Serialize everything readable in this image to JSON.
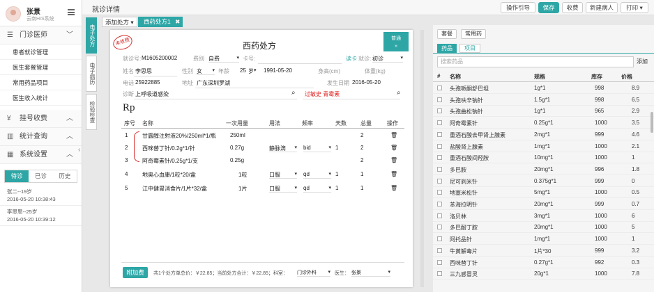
{
  "app": {
    "name": "张景",
    "subtitle": "云南HIS系统"
  },
  "sidebar": {
    "sections": [
      {
        "label": "门诊医师"
      },
      {
        "label": "挂号收费"
      },
      {
        "label": "统计查询"
      },
      {
        "label": "系统设置"
      }
    ],
    "sub_items": [
      {
        "label": "患者就诊管理"
      },
      {
        "label": "医生套餐管理"
      },
      {
        "label": "常用药品项目"
      },
      {
        "label": "医生收入统计"
      }
    ],
    "patient_tabs": [
      {
        "label": "待诊"
      },
      {
        "label": "已诊"
      },
      {
        "label": "历史"
      }
    ],
    "patients": [
      {
        "name": "张二--19岁",
        "time": "2016-05-20 10:38:43"
      },
      {
        "name": "李思思--25岁",
        "time": "2016-05-20 10:39:12"
      }
    ]
  },
  "topbar": {
    "title": "就诊详情",
    "buttons": {
      "guide": "操作引导",
      "save": "保存",
      "charge": "收费",
      "new_patient": "新建病人",
      "print": "打印"
    }
  },
  "vtabs": {
    "rx": "电子处方",
    "record": "电子病历",
    "exam": "检验检查"
  },
  "tabs": {
    "add": "添加处方",
    "rx1": "西药处方1"
  },
  "rx": {
    "stamp": "未收费",
    "title": "西药处方",
    "common_btn": "普通",
    "visit_no_label": "就诊号:",
    "visit_no": "M1605200002",
    "fee_label": "费别",
    "fee": "自费",
    "card_label": "卡号:",
    "read_card": "读卡",
    "visit_type_label": "就诊:",
    "visit_type": "初诊",
    "name_label": "姓名",
    "name": "李思思",
    "gender_label": "性别",
    "gender": "女",
    "age_label": "年龄",
    "age": "25",
    "age_unit": "岁",
    "dob": "1991-05-20",
    "height_label": "身高(cm)",
    "weight_label": "体重(kg)",
    "phone_label": "电话",
    "phone": "25922885",
    "address_label": "地址",
    "address": "广东深圳罗湖",
    "onset_label": "发生日期",
    "onset": "2016-05-20",
    "diag_label": "诊断",
    "diagnosis": "上呼吸道感染",
    "allergy": "过敏史 青霉素",
    "rp": "Rp",
    "headers": {
      "no": "序号",
      "name": "名称",
      "dose": "一次用量",
      "usage": "用法",
      "freq": "频率",
      "days": "天数",
      "total": "总量",
      "op": "操作"
    },
    "items": [
      {
        "no": "1",
        "name": "甘露醇注射液20%/250ml*1/瓶",
        "dose": "250ml",
        "usage": "",
        "freq": "",
        "days": "",
        "total": "2"
      },
      {
        "no": "2",
        "name": "西咪替丁针/0.2g*1/针",
        "dose": "0.27g",
        "usage": "静脉滴",
        "freq": "bid",
        "days": "1",
        "total": "2"
      },
      {
        "no": "3",
        "name": "阿奇霉素针/0.25g*1/支",
        "dose": "0.25g",
        "usage": "",
        "freq": "",
        "days": "",
        "total": "2"
      },
      {
        "no": "4",
        "name": "地奥心血康/1粒*20/盒",
        "dose": "1粒",
        "usage": "口服",
        "freq": "qd",
        "days": "1",
        "total": "1"
      },
      {
        "no": "5",
        "name": "江中健胃消食片/1片*32/盒",
        "dose": "1片",
        "usage": "口服",
        "freq": "qd",
        "days": "1",
        "total": "1"
      }
    ],
    "footer": {
      "add_fee_btn": "附加费",
      "summary": "共1个处方单总价：￥22.85；当前处方合计：￥22.85；科室：",
      "dept": "门诊外科",
      "doctor_label": "医生：",
      "doctor": "张景"
    }
  },
  "right": {
    "buttons": {
      "package": "套餐",
      "common": "常用药"
    },
    "tabs": {
      "drugs": "药品",
      "items": "项目"
    },
    "search_placeholder": "搜索药品",
    "add_btn": "添加",
    "headers": {
      "no": "#",
      "name": "名称",
      "spec": "规格",
      "stock": "库存",
      "price": "价格"
    },
    "drugs": [
      {
        "name": "头孢哌酮舒巴坦",
        "spec": "1g*1",
        "stock": "998",
        "price": "8.9"
      },
      {
        "name": "头孢呋辛钠针",
        "spec": "1.5g*1",
        "stock": "998",
        "price": "6.5"
      },
      {
        "name": "头孢曲松钠针",
        "spec": "1g*1",
        "stock": "965",
        "price": "2.9"
      },
      {
        "name": "阿奇霉素针",
        "spec": "0.25g*1",
        "stock": "1000",
        "price": "3.5"
      },
      {
        "name": "重酒石酸去甲肾上腺素",
        "spec": "2mg*1",
        "stock": "999",
        "price": "4.6"
      },
      {
        "name": "盐酸肾上腺素",
        "spec": "1mg*1",
        "stock": "1000",
        "price": "2.1"
      },
      {
        "name": "重酒石酸间羟胺",
        "spec": "10mg*1",
        "stock": "1000",
        "price": "1"
      },
      {
        "name": "多巴胺",
        "spec": "20mg*1",
        "stock": "996",
        "price": "1.8"
      },
      {
        "name": "尼可刹米针",
        "spec": "0.375g*1",
        "stock": "999",
        "price": "0"
      },
      {
        "name": "地塞米松针",
        "spec": "5mg*1",
        "stock": "1000",
        "price": "0.5"
      },
      {
        "name": "苯海拉明针",
        "spec": "20mg*1",
        "stock": "999",
        "price": "0.7"
      },
      {
        "name": "洛贝林",
        "spec": "3mg*1",
        "stock": "1000",
        "price": "6"
      },
      {
        "name": "多巴酚丁胺",
        "spec": "20mg*1",
        "stock": "1000",
        "price": "5"
      },
      {
        "name": "阿托品针",
        "spec": "1mg*1",
        "stock": "1000",
        "price": "1"
      },
      {
        "name": "牛黄解毒片",
        "spec": "1片*30",
        "stock": "999",
        "price": "3.2"
      },
      {
        "name": "西咪替丁针",
        "spec": "0.27g*1",
        "stock": "992",
        "price": "0.3"
      },
      {
        "name": "三九感冒灵",
        "spec": "20g*1",
        "stock": "1000",
        "price": "7.8"
      }
    ]
  },
  "colors": {
    "accent": "#2ea6a6",
    "stamp": "#d63030",
    "allergy": "#e02020"
  }
}
